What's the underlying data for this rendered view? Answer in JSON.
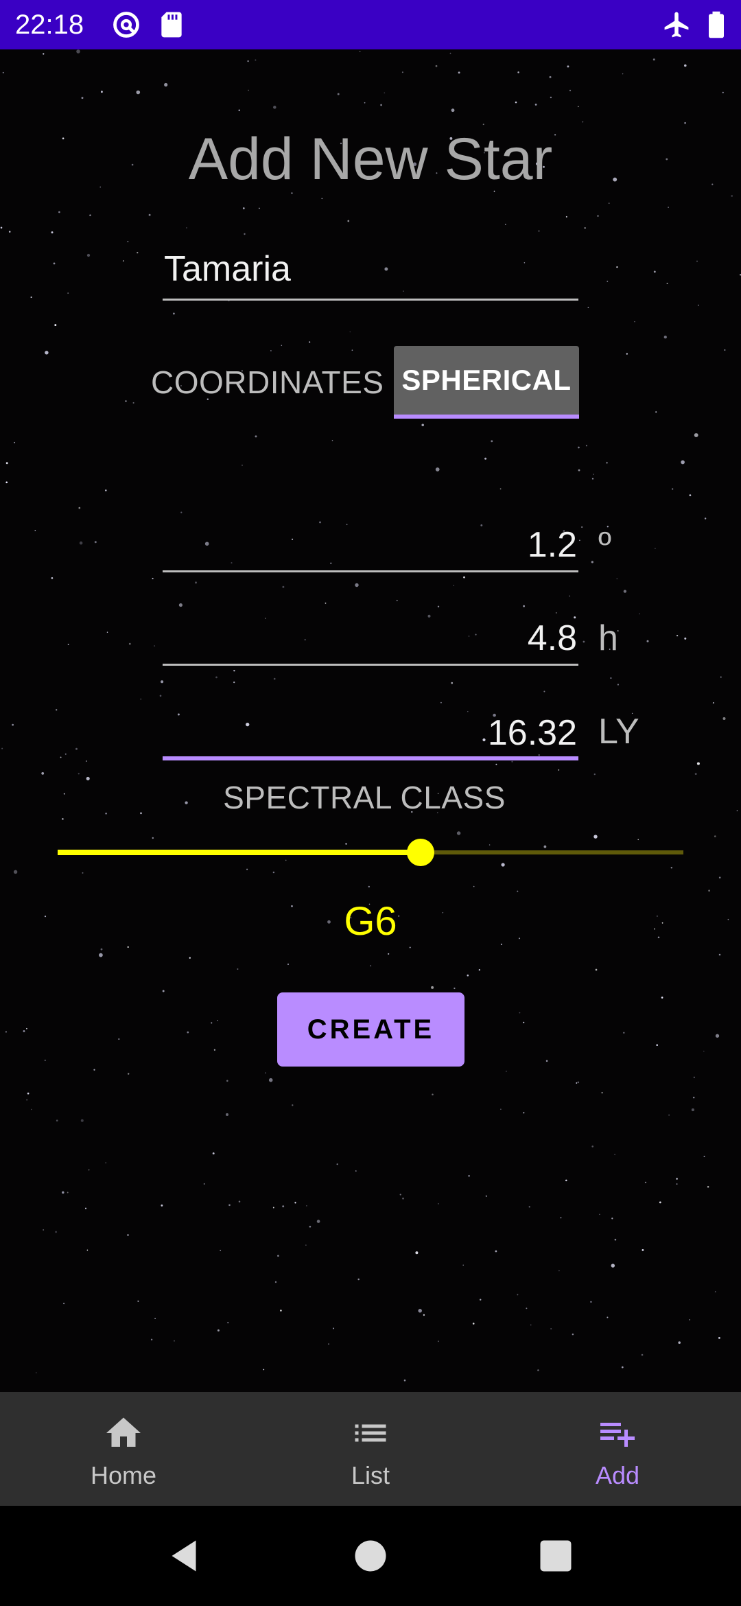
{
  "status_bar": {
    "time": "22:18",
    "left_icons": [
      "vpn-key-icon",
      "sd-card-icon"
    ],
    "right_icons": [
      "airplane-mode-icon",
      "battery-icon"
    ],
    "color": "#3a00c4"
  },
  "page": {
    "title": "Add New Star"
  },
  "form": {
    "name_value": "Tamaria",
    "coordinates_label": "COORDINATES",
    "coordinate_mode": "SPHERICAL",
    "fields": [
      {
        "value": "1.2",
        "unit": "º"
      },
      {
        "value": "4.8",
        "unit": "h"
      },
      {
        "value": "16.32",
        "unit": "LY",
        "focused": true
      }
    ],
    "spectral_label": "SPECTRAL CLASS",
    "spectral_slider_fraction": 0.58,
    "spectral_value": "G6",
    "create_label": "CREATE"
  },
  "bottom_nav": {
    "items": [
      {
        "label": "Home",
        "icon": "home-icon"
      },
      {
        "label": "List",
        "icon": "list-icon"
      },
      {
        "label": "Add",
        "icon": "playlist-add-icon",
        "active": true
      }
    ]
  },
  "system_nav": {
    "icons": [
      "back-icon",
      "home-circle-icon",
      "recents-icon"
    ]
  },
  "colors": {
    "accent": "#b98cff",
    "slider": "#ffff00",
    "spectral_text": "#ffff00"
  }
}
